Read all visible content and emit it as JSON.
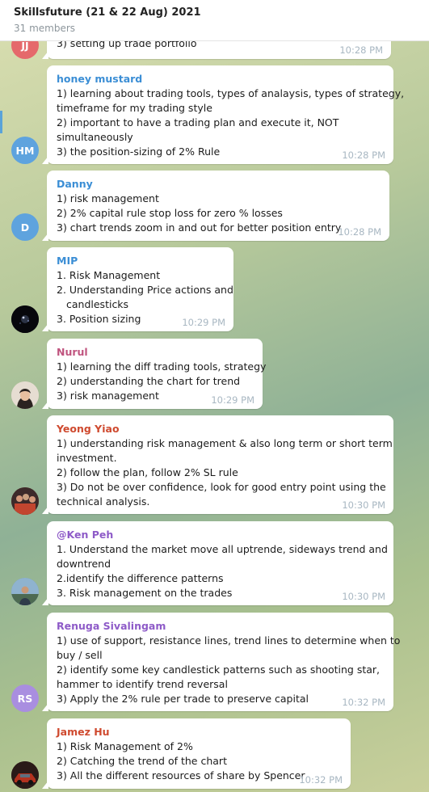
{
  "header": {
    "title": "Skillsfuture (21 & 22 Aug) 2021",
    "members": "31 members"
  },
  "colors": {
    "header_bg": "#ffffff",
    "bubble_bg": "#ffffff",
    "time_color": "#a8b7c2"
  },
  "messages": [
    {
      "sender": "",
      "avatar": {
        "type": "initials",
        "initials": "JJ",
        "color": "#e5696b"
      },
      "lines": [
        "3) setting up trade portfolio"
      ],
      "time": "10:28 PM"
    },
    {
      "sender": "honey mustard",
      "sender_color": "#3b8ed5",
      "avatar": {
        "type": "initials",
        "initials": "HM",
        "color": "#5ea3de"
      },
      "lines": [
        "1) learning about trading tools, types of analaysis, types of strategy,",
        "timeframe for my trading style",
        "2) important to have a trading plan and execute it, NOT",
        "simultaneously",
        "3) the position-sizing of 2% Rule"
      ],
      "time": "10:28 PM"
    },
    {
      "sender": "Danny",
      "sender_color": "#3b8ed5",
      "avatar": {
        "type": "initials",
        "initials": "D",
        "color": "#5ea3de"
      },
      "lines": [
        "1) risk management",
        "2) 2% capital rule stop loss for zero % losses",
        "3) chart trends zoom in and out for better position entry"
      ],
      "time": "10:28 PM"
    },
    {
      "sender": "MIP",
      "sender_color": "#3b8ed5",
      "avatar": {
        "type": "photo",
        "icon": "dark-space-photo"
      },
      "lines": [
        "1. Risk Management",
        "2. Understanding Price actions and",
        "candlesticks",
        "3. Position sizing"
      ],
      "time": "10:29 PM"
    },
    {
      "sender": "Nurul",
      "sender_color": "#c0547f",
      "avatar": {
        "type": "photo",
        "icon": "woman-portrait-photo"
      },
      "lines": [
        "1) learning the diff trading tools, strategy",
        "2) understanding the chart for trend",
        "3) risk management"
      ],
      "time": "10:29 PM"
    },
    {
      "sender": "Yeong Yiao",
      "sender_color": "#cf4a2f",
      "avatar": {
        "type": "photo",
        "icon": "group-photo"
      },
      "lines": [
        "1) understanding risk management & also long term or short term",
        "investment.",
        "2) follow the plan, follow 2% SL rule",
        "3) Do not be over confidence, look for good entry point using the",
        "technical analysis."
      ],
      "time": "10:30 PM"
    },
    {
      "sender": "@Ken Peh",
      "sender_color": "#8e5bc8",
      "avatar": {
        "type": "photo",
        "icon": "outdoor-person-photo"
      },
      "lines": [
        "1. Understand the market move all uptrende, sideways trend and",
        "downtrend",
        "2.identify the difference patterns",
        "3. Risk management on the trades"
      ],
      "time": "10:30 PM"
    },
    {
      "sender": "Renuga Sivalingam",
      "sender_color": "#8e5bc8",
      "avatar": {
        "type": "initials",
        "initials": "RS",
        "color": "#a98ee0"
      },
      "lines": [
        "1) use of support, resistance lines, trend lines to determine when to",
        "buy / sell",
        "2) identify some key candlestick patterns such as shooting star,",
        "hammer to identify trend reversal",
        "3) Apply the 2% rule per trade to preserve capital"
      ],
      "time": "10:32 PM"
    },
    {
      "sender": "Jamez Hu",
      "sender_color": "#cf4a2f",
      "avatar": {
        "type": "photo",
        "icon": "car-photo"
      },
      "lines": [
        "1) Risk Management of 2%",
        "2) Catching the trend of the chart",
        "3) All the different resources of share by Spencer"
      ],
      "time": "10:32 PM"
    }
  ]
}
